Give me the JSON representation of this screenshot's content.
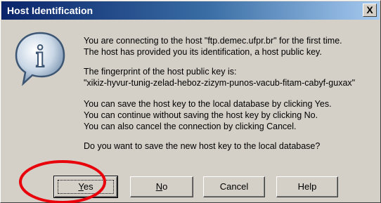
{
  "window": {
    "title": "Host Identification",
    "close_label": "X"
  },
  "icon": {
    "name": "info-icon",
    "glyph": "i"
  },
  "message": {
    "line1": "You are connecting to the host \"ftp.demec.ufpr.br\" for the first time.",
    "line2": "The host has provided you its identification, a host public key.",
    "line3": "The fingerprint of the host public key is:",
    "line4": "\"xikiz-hyvur-tunig-zelad-heboz-zizym-punos-vacub-fitam-cabyf-guxax\"",
    "line5": "You can save the host key to the local database by clicking Yes.",
    "line6": "You can continue without saving the host key by clicking No.",
    "line7": "You can also cancel the connection by clicking Cancel.",
    "line8": "Do you want to save the new host key to the local database?"
  },
  "buttons": {
    "yes": {
      "mnemonic": "Y",
      "rest": "es"
    },
    "no": {
      "mnemonic": "N",
      "rest": "o"
    },
    "cancel": "Cancel",
    "help": "Help"
  },
  "colors": {
    "dialog_bg": "#d4d0c8",
    "title_start": "#0a246a",
    "title_end": "#a6caf0",
    "annotation": "#e8000b"
  }
}
